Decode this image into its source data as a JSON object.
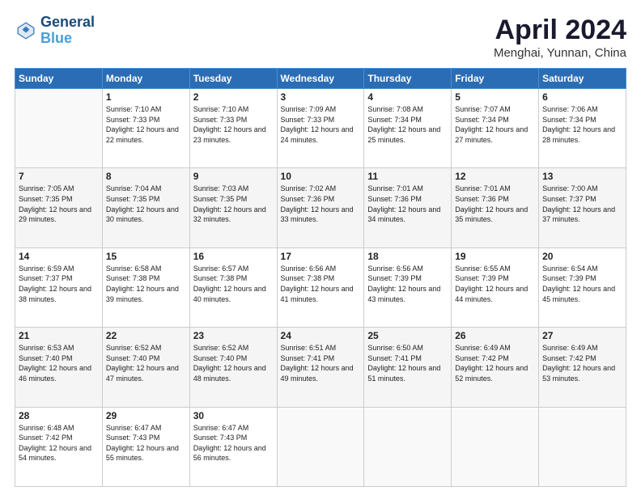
{
  "header": {
    "logo_line1": "General",
    "logo_line2": "Blue",
    "month": "April 2024",
    "location": "Menghai, Yunnan, China"
  },
  "weekdays": [
    "Sunday",
    "Monday",
    "Tuesday",
    "Wednesday",
    "Thursday",
    "Friday",
    "Saturday"
  ],
  "weeks": [
    [
      {
        "day": "",
        "sunrise": "",
        "sunset": "",
        "daylight": ""
      },
      {
        "day": "1",
        "sunrise": "7:10 AM",
        "sunset": "7:33 PM",
        "daylight": "12 hours and 22 minutes."
      },
      {
        "day": "2",
        "sunrise": "7:10 AM",
        "sunset": "7:33 PM",
        "daylight": "12 hours and 23 minutes."
      },
      {
        "day": "3",
        "sunrise": "7:09 AM",
        "sunset": "7:33 PM",
        "daylight": "12 hours and 24 minutes."
      },
      {
        "day": "4",
        "sunrise": "7:08 AM",
        "sunset": "7:34 PM",
        "daylight": "12 hours and 25 minutes."
      },
      {
        "day": "5",
        "sunrise": "7:07 AM",
        "sunset": "7:34 PM",
        "daylight": "12 hours and 27 minutes."
      },
      {
        "day": "6",
        "sunrise": "7:06 AM",
        "sunset": "7:34 PM",
        "daylight": "12 hours and 28 minutes."
      }
    ],
    [
      {
        "day": "7",
        "sunrise": "7:05 AM",
        "sunset": "7:35 PM",
        "daylight": "12 hours and 29 minutes."
      },
      {
        "day": "8",
        "sunrise": "7:04 AM",
        "sunset": "7:35 PM",
        "daylight": "12 hours and 30 minutes."
      },
      {
        "day": "9",
        "sunrise": "7:03 AM",
        "sunset": "7:35 PM",
        "daylight": "12 hours and 32 minutes."
      },
      {
        "day": "10",
        "sunrise": "7:02 AM",
        "sunset": "7:36 PM",
        "daylight": "12 hours and 33 minutes."
      },
      {
        "day": "11",
        "sunrise": "7:01 AM",
        "sunset": "7:36 PM",
        "daylight": "12 hours and 34 minutes."
      },
      {
        "day": "12",
        "sunrise": "7:01 AM",
        "sunset": "7:36 PM",
        "daylight": "12 hours and 35 minutes."
      },
      {
        "day": "13",
        "sunrise": "7:00 AM",
        "sunset": "7:37 PM",
        "daylight": "12 hours and 37 minutes."
      }
    ],
    [
      {
        "day": "14",
        "sunrise": "6:59 AM",
        "sunset": "7:37 PM",
        "daylight": "12 hours and 38 minutes."
      },
      {
        "day": "15",
        "sunrise": "6:58 AM",
        "sunset": "7:38 PM",
        "daylight": "12 hours and 39 minutes."
      },
      {
        "day": "16",
        "sunrise": "6:57 AM",
        "sunset": "7:38 PM",
        "daylight": "12 hours and 40 minutes."
      },
      {
        "day": "17",
        "sunrise": "6:56 AM",
        "sunset": "7:38 PM",
        "daylight": "12 hours and 41 minutes."
      },
      {
        "day": "18",
        "sunrise": "6:56 AM",
        "sunset": "7:39 PM",
        "daylight": "12 hours and 43 minutes."
      },
      {
        "day": "19",
        "sunrise": "6:55 AM",
        "sunset": "7:39 PM",
        "daylight": "12 hours and 44 minutes."
      },
      {
        "day": "20",
        "sunrise": "6:54 AM",
        "sunset": "7:39 PM",
        "daylight": "12 hours and 45 minutes."
      }
    ],
    [
      {
        "day": "21",
        "sunrise": "6:53 AM",
        "sunset": "7:40 PM",
        "daylight": "12 hours and 46 minutes."
      },
      {
        "day": "22",
        "sunrise": "6:52 AM",
        "sunset": "7:40 PM",
        "daylight": "12 hours and 47 minutes."
      },
      {
        "day": "23",
        "sunrise": "6:52 AM",
        "sunset": "7:40 PM",
        "daylight": "12 hours and 48 minutes."
      },
      {
        "day": "24",
        "sunrise": "6:51 AM",
        "sunset": "7:41 PM",
        "daylight": "12 hours and 49 minutes."
      },
      {
        "day": "25",
        "sunrise": "6:50 AM",
        "sunset": "7:41 PM",
        "daylight": "12 hours and 51 minutes."
      },
      {
        "day": "26",
        "sunrise": "6:49 AM",
        "sunset": "7:42 PM",
        "daylight": "12 hours and 52 minutes."
      },
      {
        "day": "27",
        "sunrise": "6:49 AM",
        "sunset": "7:42 PM",
        "daylight": "12 hours and 53 minutes."
      }
    ],
    [
      {
        "day": "28",
        "sunrise": "6:48 AM",
        "sunset": "7:42 PM",
        "daylight": "12 hours and 54 minutes."
      },
      {
        "day": "29",
        "sunrise": "6:47 AM",
        "sunset": "7:43 PM",
        "daylight": "12 hours and 55 minutes."
      },
      {
        "day": "30",
        "sunrise": "6:47 AM",
        "sunset": "7:43 PM",
        "daylight": "12 hours and 56 minutes."
      },
      {
        "day": "",
        "sunrise": "",
        "sunset": "",
        "daylight": ""
      },
      {
        "day": "",
        "sunrise": "",
        "sunset": "",
        "daylight": ""
      },
      {
        "day": "",
        "sunrise": "",
        "sunset": "",
        "daylight": ""
      },
      {
        "day": "",
        "sunrise": "",
        "sunset": "",
        "daylight": ""
      }
    ]
  ]
}
